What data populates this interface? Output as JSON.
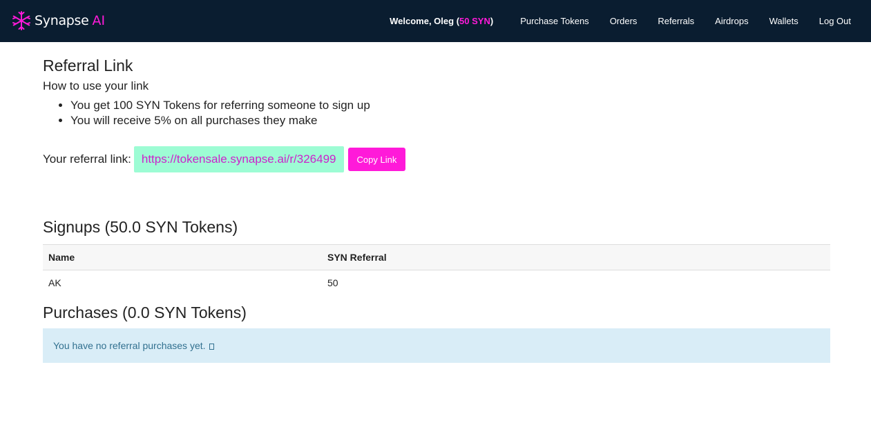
{
  "brand": {
    "name": "Synapse",
    "ai": "AI",
    "logo_icon": "asterisk-snowflake-icon",
    "logo_color": "#ff1ad9"
  },
  "nav": {
    "welcome_prefix": "Welcome, Oleg (",
    "welcome_balance": "50 SYN",
    "welcome_suffix": ")",
    "links": [
      {
        "label": "Purchase Tokens"
      },
      {
        "label": "Orders"
      },
      {
        "label": "Referrals"
      },
      {
        "label": "Airdrops"
      },
      {
        "label": "Wallets"
      },
      {
        "label": "Log Out"
      }
    ]
  },
  "referral": {
    "title": "Referral Link",
    "howto": "How to use your link",
    "rules": [
      "You get 100 SYN Tokens for referring someone to sign up",
      "You will receive 5% on all purchases they make"
    ],
    "link_label": "Your referral link:",
    "link_url": "https://tokensale.synapse.ai/r/326499",
    "copy_label": "Copy Link"
  },
  "signups": {
    "title": "Signups (50.0 SYN Tokens)",
    "columns": [
      "Name",
      "SYN Referral"
    ],
    "rows": [
      {
        "name": "AK",
        "referral": "50"
      }
    ]
  },
  "purchases": {
    "title": "Purchases (0.0 SYN Tokens)",
    "empty_message": "You have no referral purchases yet."
  },
  "colors": {
    "navbar_bg": "#0a1d30",
    "accent": "#ff1ad9",
    "link_box_bg": "#9dfcd4",
    "alert_bg": "#d9edf7"
  }
}
